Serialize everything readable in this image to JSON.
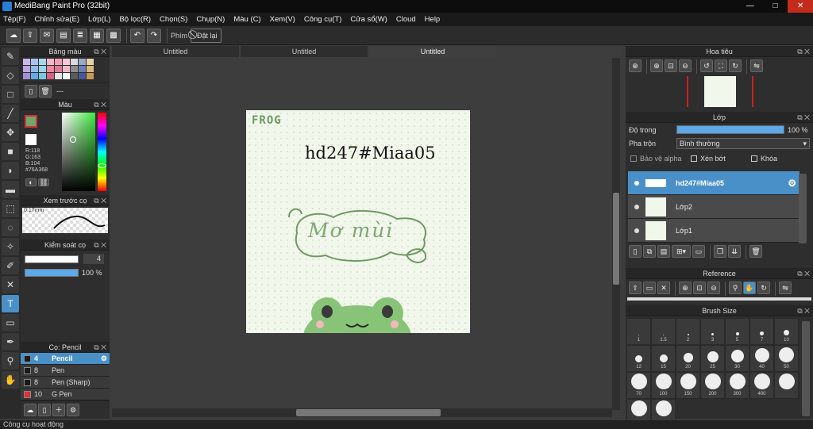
{
  "window": {
    "title": "MediBang Paint Pro (32bit)",
    "min": "—",
    "max": "□",
    "close": "✕"
  },
  "menu": [
    "Tệp(F)",
    "Chỉnh sửa(E)",
    "Lớp(L)",
    "Bộ lọc(R)",
    "Chọn(S)",
    "Chụp(N)",
    "Màu (C)",
    "Xem(V)",
    "Công cụ(T)",
    "Cửa sổ(W)",
    "Cloud",
    "Help"
  ],
  "toolbar": {
    "key_label": "Phím",
    "reset_label": "Đặt lại"
  },
  "palette": {
    "title": "Bảng màu",
    "empty": "---",
    "swatches": [
      "#c9b8e8",
      "#a9c4f0",
      "#a8d8f0",
      "#f7b6c9",
      "#f3a0b5",
      "#f8c8d8",
      "#d9d9d9",
      "#9aa7c9",
      "#e6d2a8",
      "#b9a6e0",
      "#8fbce8",
      "#9ad4e8",
      "#e88aa0",
      "#e07a95",
      "#f2b8c8",
      "#8c8c8c",
      "#6c7fb0",
      "#d8b880",
      "#a090d8",
      "#6aa8e0",
      "#78c8e0",
      "#d86080",
      "#e6e6e6",
      "#ffffff",
      "#5a5a5a",
      "#44589a",
      "#c89858"
    ]
  },
  "color": {
    "title": "Màu",
    "r": "R:118",
    "g": "G:163",
    "b": "B:104",
    "hex": "#76A368",
    "primary": "#76A368"
  },
  "preview": {
    "title": "Xem trước cọ",
    "size": "0.17mm"
  },
  "brushctl": {
    "title": "Kiểm soát cọ",
    "size": "4",
    "opacity": "100 %"
  },
  "brushes": {
    "title": "Cọ: Pencil",
    "items": [
      {
        "num": "4",
        "name": "Pencil",
        "color": "#1a1a1a"
      },
      {
        "num": "8",
        "name": "Pen",
        "color": "#1a1a1a"
      },
      {
        "num": "8",
        "name": "Pen (Sharp)",
        "color": "#1a1a1a"
      },
      {
        "num": "10",
        "name": "G Pen",
        "color": "#e03030"
      }
    ]
  },
  "tabs": [
    "Untitled",
    "Untitled",
    "Untitled"
  ],
  "artwork": {
    "frog_label": "FROG",
    "main_text": "hd247#Miaa05",
    "banner_text": "Mơ mùi"
  },
  "navigator": {
    "title": "Hoa tiêu"
  },
  "layers": {
    "title": "Lớp",
    "opacity_label": "Độ trong",
    "opacity_value": "100 %",
    "opacity": 1.0,
    "blend_label": "Pha trộn",
    "blend_value": "Bình thường",
    "alpha_label": "Bảo vệ alpha",
    "clip_label": "Xén bớt",
    "lock_label": "Khóa",
    "items": [
      {
        "name": "hd247#Miaa05",
        "selected": true
      },
      {
        "name": "Lớp2",
        "selected": false
      },
      {
        "name": "Lớp1",
        "selected": false
      }
    ]
  },
  "reference": {
    "title": "Reference"
  },
  "brushsize": {
    "title": "Brush Size",
    "sizes": [
      "1",
      "1.5",
      "2",
      "3",
      "5",
      "7",
      "10",
      "12",
      "15",
      "20",
      "25",
      "30",
      "40",
      "50",
      "70",
      "100",
      "150",
      "200",
      "300",
      "400",
      "",
      "",
      ""
    ]
  },
  "status": {
    "text": "Công cụ hoạt động"
  }
}
